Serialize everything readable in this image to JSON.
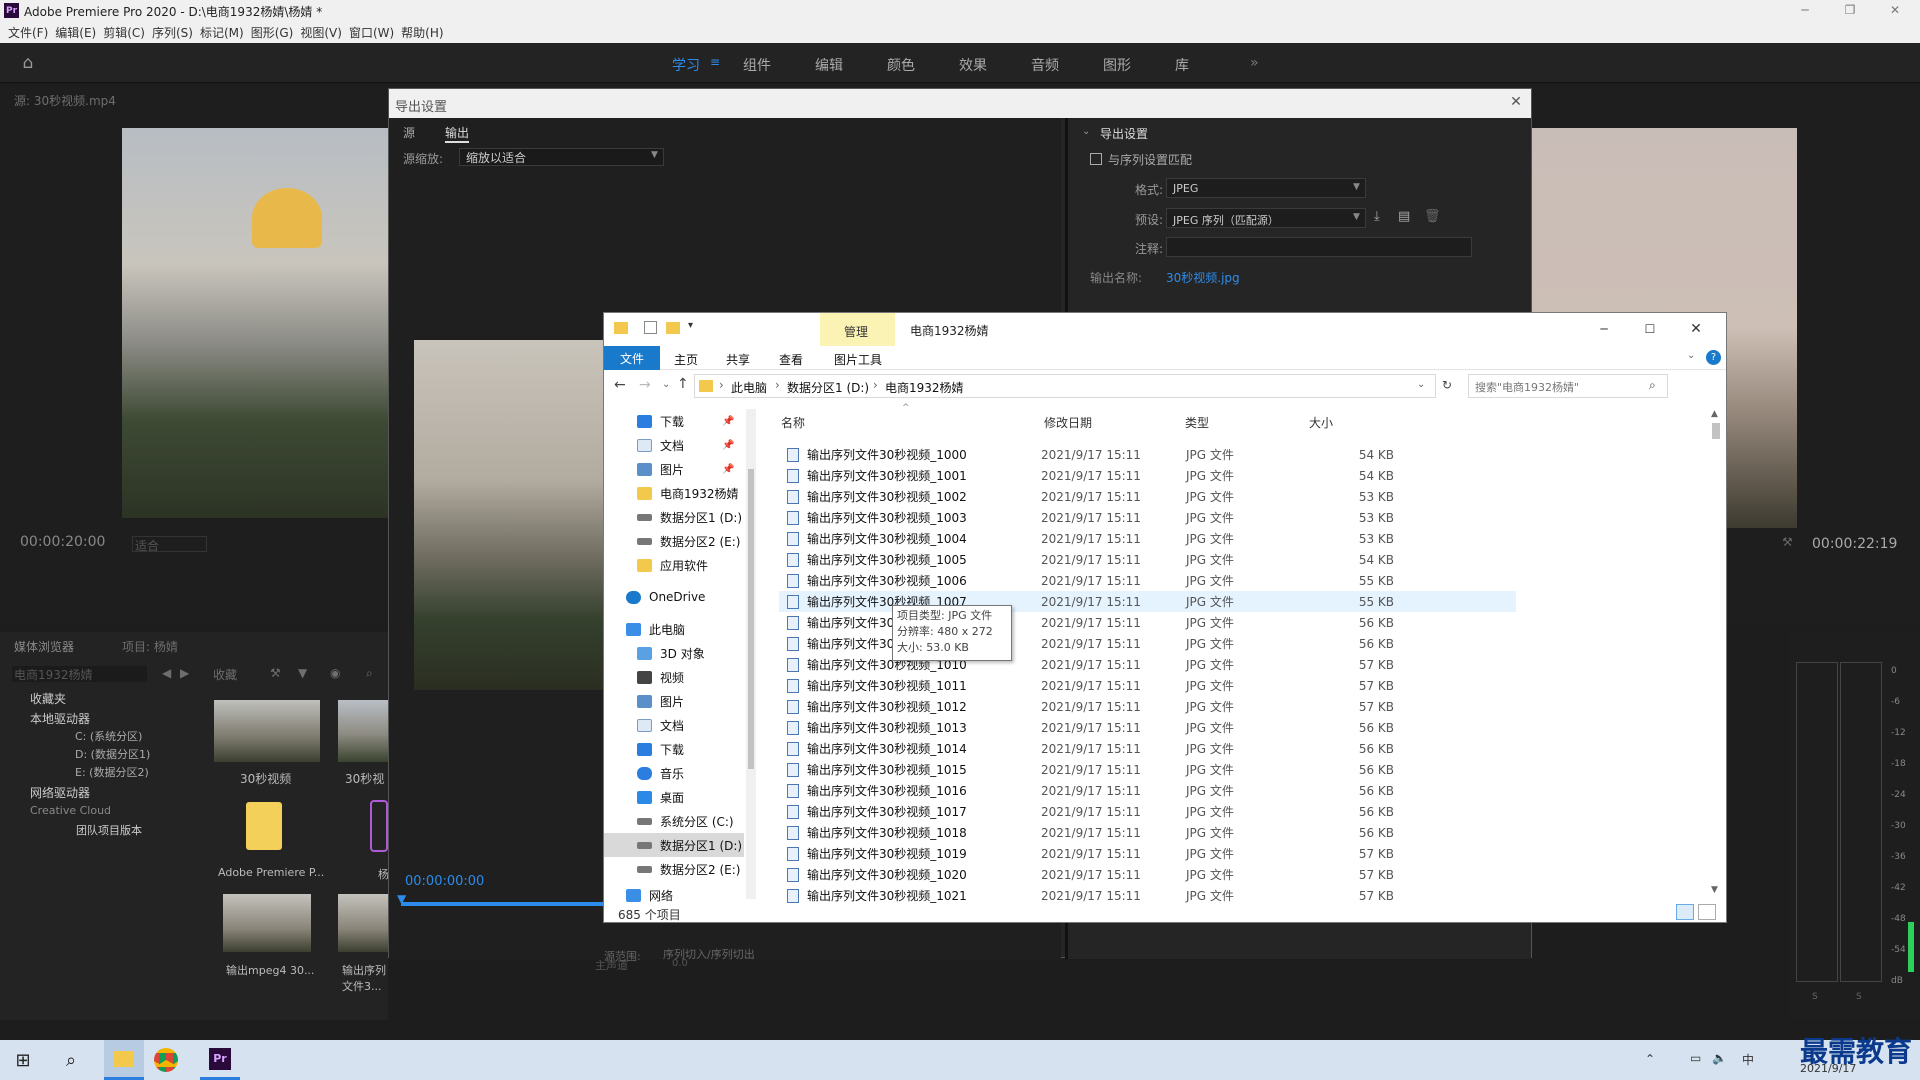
{
  "premiere": {
    "title": "Adobe Premiere Pro 2020 - D:\\电商1932杨婧\\杨婧 *",
    "menu": [
      "文件(F)",
      "编辑(E)",
      "剪辑(C)",
      "序列(S)",
      "标记(M)",
      "图形(G)",
      "视图(V)",
      "窗口(W)",
      "帮助(H)"
    ],
    "workspaces": [
      "学习",
      "组件",
      "编辑",
      "颜色",
      "效果",
      "音频",
      "图形",
      "库"
    ],
    "source_tab": "源: 30秒视频.mp4",
    "source_timecode": "00:00:20:00",
    "source_fit": "适合",
    "program_timecode": "00:00:22:19",
    "media_browser_tab": "媒体浏览器",
    "project_tab": "项目: 杨婧",
    "media_path": "电商1932杨婧",
    "favorites_label": "收藏",
    "tree": [
      "收藏夹",
      "本地驱动器",
      "C: (系统分区)",
      "D: (数据分区1)",
      "E: (数据分区2)",
      "网络驱动器",
      "Creative Cloud",
      "团队项目版本"
    ],
    "thumbs": [
      "30秒视频",
      "30秒视",
      "Adobe Premiere P...",
      "杨",
      "输出mpeg4 30...",
      "输出序列文件3..."
    ],
    "meter_ticks": [
      "0",
      "-6",
      "-12",
      "-18",
      "-24",
      "-30",
      "-36",
      "-42",
      "-48",
      "-54",
      "dB"
    ],
    "meter_solo": [
      "S",
      "S"
    ],
    "master_track": "主声道",
    "master_val": "0.0"
  },
  "export": {
    "title": "导出设置",
    "tabs": [
      "源",
      "输出"
    ],
    "source_scale_label": "源缩放:",
    "source_scale_value": "缩放以适合",
    "timecode": "00:00:00:00",
    "range_label": "源范围:",
    "range_value": "序列切入/序列切出",
    "settings_heading": "导出设置",
    "match_seq": "与序列设置匹配",
    "format_label": "格式:",
    "format_value": "JPEG",
    "preset_label": "预设:",
    "preset_value": "JPEG 序列（匹配源）",
    "comment_label": "注释:",
    "output_name_label": "输出名称:",
    "output_name_value": "30秒视频.jpg"
  },
  "explorer": {
    "title": "电商1932杨婧",
    "manage_tab": "管理",
    "ribbon_tabs": [
      "文件",
      "主页",
      "共享",
      "查看",
      "图片工具"
    ],
    "breadcrumb": [
      "此电脑",
      "数据分区1 (D:)",
      "电商1932杨婧"
    ],
    "search_placeholder": "搜索\"电商1932杨婧\"",
    "quick_access": [
      "下载",
      "文档",
      "图片",
      "电商1932杨婧",
      "数据分区1 (D:)",
      "数据分区2 (E:)",
      "应用软件"
    ],
    "onedrive": "OneDrive",
    "this_pc": "此电脑",
    "pc_items": [
      "3D 对象",
      "视频",
      "图片",
      "文档",
      "下载",
      "音乐",
      "桌面",
      "系统分区 (C:)",
      "数据分区1 (D:)",
      "数据分区2 (E:)"
    ],
    "network": "网络",
    "columns": [
      "名称",
      "修改日期",
      "类型",
      "大小"
    ],
    "files": [
      {
        "name": "输出序列文件30秒视频_1000",
        "date": "2021/9/17 15:11",
        "type": "JPG 文件",
        "size": "54 KB"
      },
      {
        "name": "输出序列文件30秒视频_1001",
        "date": "2021/9/17 15:11",
        "type": "JPG 文件",
        "size": "54 KB"
      },
      {
        "name": "输出序列文件30秒视频_1002",
        "date": "2021/9/17 15:11",
        "type": "JPG 文件",
        "size": "53 KB"
      },
      {
        "name": "输出序列文件30秒视频_1003",
        "date": "2021/9/17 15:11",
        "type": "JPG 文件",
        "size": "53 KB"
      },
      {
        "name": "输出序列文件30秒视频_1004",
        "date": "2021/9/17 15:11",
        "type": "JPG 文件",
        "size": "53 KB"
      },
      {
        "name": "输出序列文件30秒视频_1005",
        "date": "2021/9/17 15:11",
        "type": "JPG 文件",
        "size": "54 KB"
      },
      {
        "name": "输出序列文件30秒视频_1006",
        "date": "2021/9/17 15:11",
        "type": "JPG 文件",
        "size": "55 KB"
      },
      {
        "name": "输出序列文件30秒视频_1007",
        "date": "2021/9/17 15:11",
        "type": "JPG 文件",
        "size": "55 KB"
      },
      {
        "name": "输出序列文件30秒视频_1008",
        "date": "2021/9/17 15:11",
        "type": "JPG 文件",
        "size": "56 KB"
      },
      {
        "name": "输出序列文件30秒视频_1009",
        "date": "2021/9/17 15:11",
        "type": "JPG 文件",
        "size": "56 KB"
      },
      {
        "name": "输出序列文件30秒视频_1010",
        "date": "2021/9/17 15:11",
        "type": "JPG 文件",
        "size": "57 KB"
      },
      {
        "name": "输出序列文件30秒视频_1011",
        "date": "2021/9/17 15:11",
        "type": "JPG 文件",
        "size": "57 KB"
      },
      {
        "name": "输出序列文件30秒视频_1012",
        "date": "2021/9/17 15:11",
        "type": "JPG 文件",
        "size": "57 KB"
      },
      {
        "name": "输出序列文件30秒视频_1013",
        "date": "2021/9/17 15:11",
        "type": "JPG 文件",
        "size": "56 KB"
      },
      {
        "name": "输出序列文件30秒视频_1014",
        "date": "2021/9/17 15:11",
        "type": "JPG 文件",
        "size": "56 KB"
      },
      {
        "name": "输出序列文件30秒视频_1015",
        "date": "2021/9/17 15:11",
        "type": "JPG 文件",
        "size": "56 KB"
      },
      {
        "name": "输出序列文件30秒视频_1016",
        "date": "2021/9/17 15:11",
        "type": "JPG 文件",
        "size": "56 KB"
      },
      {
        "name": "输出序列文件30秒视频_1017",
        "date": "2021/9/17 15:11",
        "type": "JPG 文件",
        "size": "56 KB"
      },
      {
        "name": "输出序列文件30秒视频_1018",
        "date": "2021/9/17 15:11",
        "type": "JPG 文件",
        "size": "56 KB"
      },
      {
        "name": "输出序列文件30秒视频_1019",
        "date": "2021/9/17 15:11",
        "type": "JPG 文件",
        "size": "57 KB"
      },
      {
        "name": "输出序列文件30秒视频_1020",
        "date": "2021/9/17 15:11",
        "type": "JPG 文件",
        "size": "57 KB"
      },
      {
        "name": "输出序列文件30秒视频_1021",
        "date": "2021/9/17 15:11",
        "type": "JPG 文件",
        "size": "57 KB"
      }
    ],
    "tooltip": [
      "项目类型: JPG 文件",
      "分辨率: 480 x 272",
      "大小: 53.0 KB"
    ],
    "status": "685 个项目"
  },
  "tray": {
    "ime": "中",
    "date": "2021/9/17",
    "watermark": "最需教育"
  }
}
